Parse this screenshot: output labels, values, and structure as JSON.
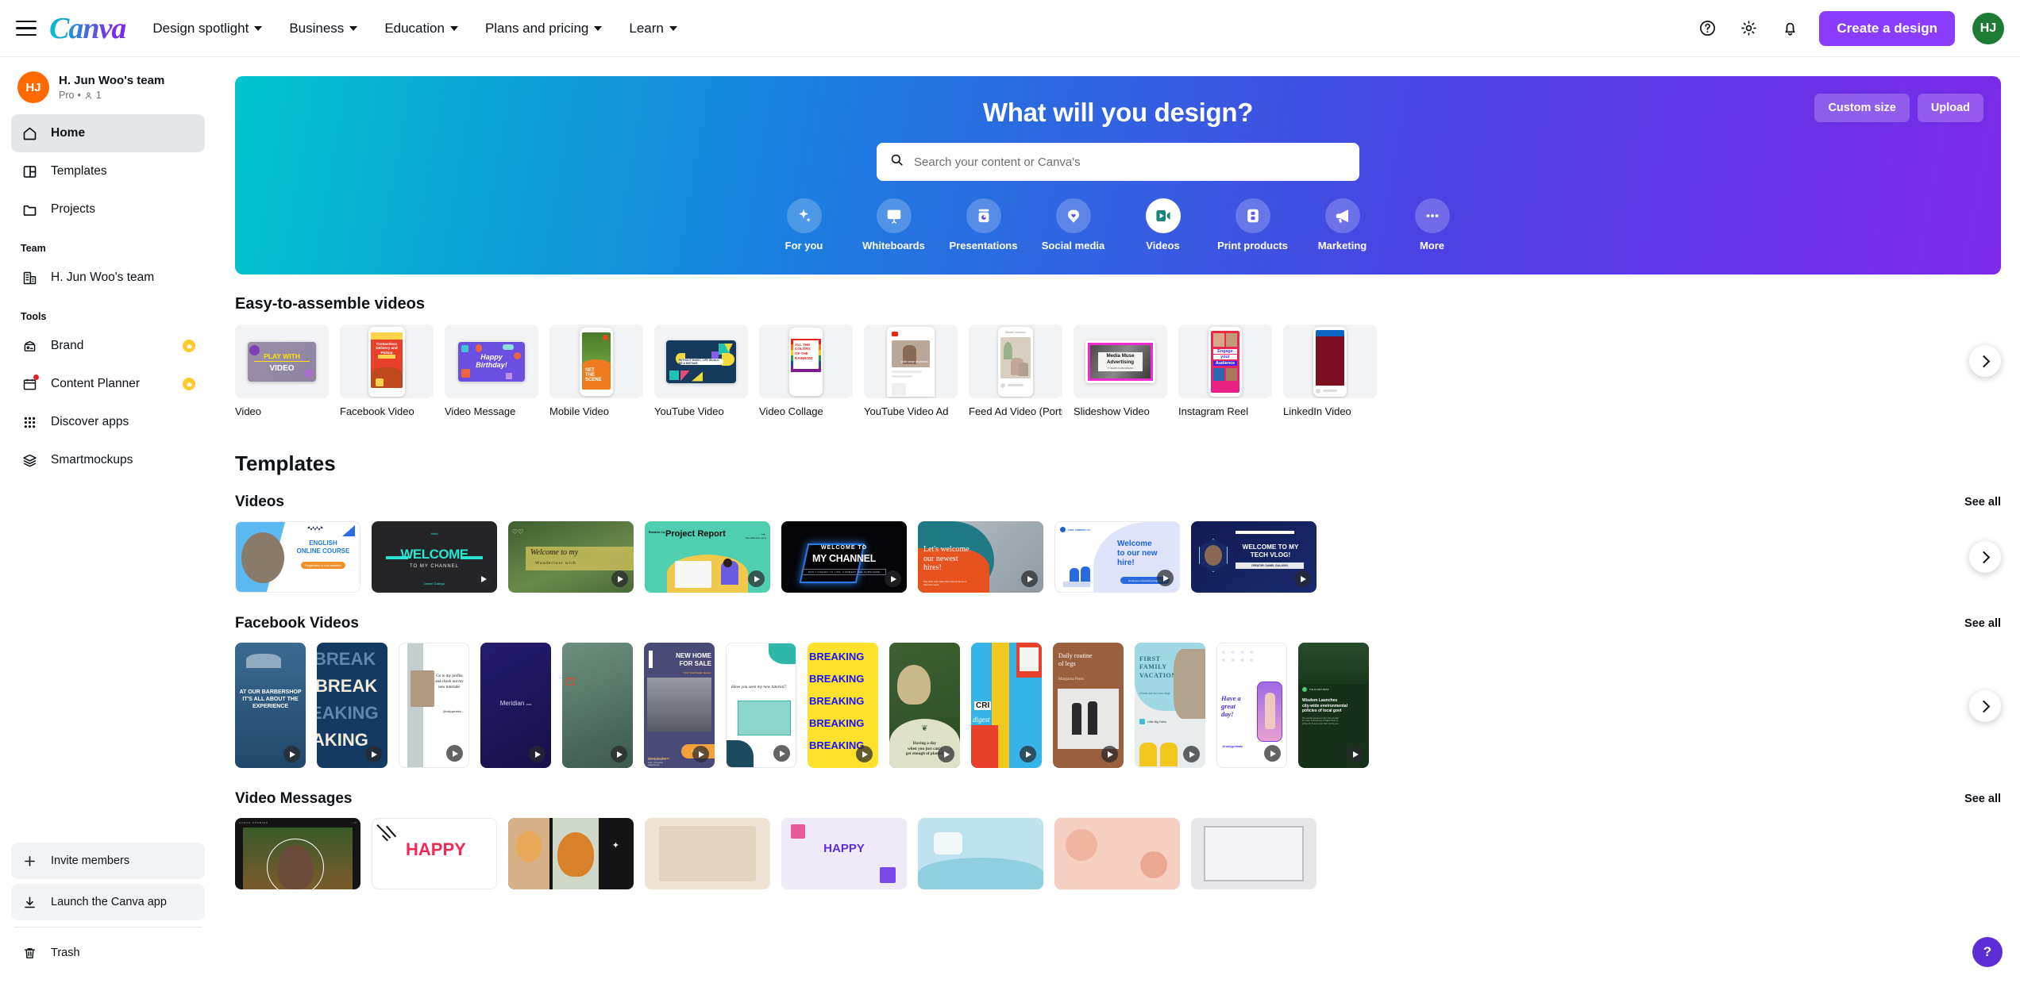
{
  "topnav": {
    "logo": "Canva",
    "menu_icon": "hamburger-icon",
    "links": [
      {
        "label": "Design spotlight"
      },
      {
        "label": "Business"
      },
      {
        "label": "Education"
      },
      {
        "label": "Plans and pricing"
      },
      {
        "label": "Learn"
      }
    ],
    "help_icon": "help-circle-icon",
    "settings_icon": "gear-icon",
    "notifications_icon": "bell-icon",
    "create_button": "Create a design",
    "avatar_initials": "HJ",
    "avatar_color": "#1e7b34",
    "create_button_color": "#8b3dff"
  },
  "sidebar": {
    "team": {
      "initials": "HJ",
      "avatar_color": "#ff6a00",
      "name": "H. Jun Woo's team",
      "plan": "Pro",
      "separator": "•",
      "members": "1"
    },
    "nav": [
      {
        "label": "Home",
        "icon": "home-icon",
        "active": true
      },
      {
        "label": "Templates",
        "icon": "templates-icon",
        "active": false
      },
      {
        "label": "Projects",
        "icon": "folder-icon",
        "active": false
      }
    ],
    "team_section_label": "Team",
    "team_items": [
      {
        "label": "H. Jun Woo's team",
        "icon": "building-icon"
      }
    ],
    "tools_section_label": "Tools",
    "tools": [
      {
        "label": "Brand",
        "icon": "brand-icon",
        "pro": true,
        "badge": false
      },
      {
        "label": "Content Planner",
        "icon": "calendar-icon",
        "pro": true,
        "badge": true
      },
      {
        "label": "Discover apps",
        "icon": "grid-apps-icon",
        "pro": false,
        "badge": false
      },
      {
        "label": "Smartmockups",
        "icon": "layers-icon",
        "pro": false,
        "badge": false
      }
    ],
    "bottom": [
      {
        "label": "Invite members",
        "icon": "plus-icon"
      },
      {
        "label": "Launch the Canva app",
        "icon": "download-icon"
      }
    ],
    "trash": {
      "label": "Trash",
      "icon": "trash-icon"
    }
  },
  "hero": {
    "title": "What will you design?",
    "search_placeholder": "Search your content or Canva's",
    "search_value": "",
    "search_icon": "search-icon",
    "custom_size_button": "Custom size",
    "upload_button": "Upload",
    "categories": [
      {
        "label": "For you",
        "icon": "sparkle-icon",
        "selected": false
      },
      {
        "label": "Whiteboards",
        "icon": "whiteboard-icon",
        "selected": false
      },
      {
        "label": "Presentations",
        "icon": "presentation-icon",
        "selected": false
      },
      {
        "label": "Social media",
        "icon": "social-heart-icon",
        "selected": false
      },
      {
        "label": "Videos",
        "icon": "video-camera-icon",
        "selected": true
      },
      {
        "label": "Print products",
        "icon": "print-icon",
        "selected": false
      },
      {
        "label": "Marketing",
        "icon": "megaphone-icon",
        "selected": false
      },
      {
        "label": "More",
        "icon": "ellipsis-icon",
        "selected": false
      }
    ]
  },
  "easy_section": {
    "title": "Easy-to-assemble videos",
    "cards": [
      {
        "label": "Video",
        "art": "play-with-video"
      },
      {
        "label": "Facebook Video",
        "art": "contactless-delivery"
      },
      {
        "label": "Video Message",
        "art": "happy-birthday"
      },
      {
        "label": "Mobile Video",
        "art": "set-the-scene"
      },
      {
        "label": "YouTube Video",
        "art": "without-music"
      },
      {
        "label": "Video Collage",
        "art": "colors-rainbow"
      },
      {
        "label": "YouTube Video Ad",
        "art": "youtube-ad"
      },
      {
        "label": "Feed Ad Video (Portrait)",
        "art": "feed-ad"
      },
      {
        "label": "Slideshow Video",
        "art": "media-muse"
      },
      {
        "label": "Instagram Reel",
        "art": "engage-audience"
      },
      {
        "label": "LinkedIn Video",
        "art": "linkedin-video"
      }
    ]
  },
  "templates": {
    "title": "Templates",
    "rows": [
      {
        "title": "Videos",
        "see_all": "See all",
        "items": [
          {
            "art": "english-online-course",
            "caption": "ENGLISH ONLINE COURSE",
            "bg": "#ffffff",
            "fg": "#1f7ae0",
            "play": false
          },
          {
            "art": "welcome-channel-dark",
            "caption": "WELCOME",
            "bg": "#252528",
            "fg": "#2ae3d0",
            "play": true
          },
          {
            "art": "welcome-wanderlust",
            "caption": "Welcome to my channel",
            "bg": "#4c6b3c",
            "fg": "#ffffff",
            "play": true
          },
          {
            "art": "project-report",
            "caption": "Project Report",
            "bg": "#4fcfb0",
            "fg": "#101010",
            "play": true
          },
          {
            "art": "my-channel-neon",
            "caption": "WELCOME TO MY CHANNEL",
            "bg": "#050507",
            "fg": "#ffffff",
            "play": true
          },
          {
            "art": "newest-hires",
            "caption": "Let's welcome our newest hires!",
            "bg": "#e8521f",
            "fg": "#ffffff",
            "play": true
          },
          {
            "art": "welcome-new-hire",
            "caption": "Welcome to our new hire!",
            "bg": "#eceefb",
            "fg": "#1c62d6",
            "play": true
          },
          {
            "art": "tech-vlog",
            "caption": "WELCOME TO MY TECH VLOG!",
            "bg": "#101a4d",
            "fg": "#ffffff",
            "play": true
          }
        ]
      },
      {
        "title": "Facebook Videos",
        "see_all": "See all",
        "items": [
          {
            "art": "barbershop",
            "caption": "AT OUR BARBERSHOP IT'S ALL ABOUT THE EXPERIENCE",
            "bg": "#2c5a82",
            "fg": "#ffffff",
            "play": true
          },
          {
            "art": "breaking-blue",
            "caption": "BREAKING",
            "bg": "#123a63",
            "fg": "#f2ead6",
            "play": true
          },
          {
            "art": "tutorials-profile",
            "caption": "Go to my profile and check out my new tutorials!",
            "bg": "#ffffff",
            "fg": "#101010",
            "play": true
          },
          {
            "art": "meridian",
            "caption": "Meridian",
            "bg": "#221b66",
            "fg": "#dcdcf5",
            "play": true
          },
          {
            "art": "teal-texture",
            "caption": "",
            "bg": "#5f7f72",
            "fg": "#ffffff",
            "play": true
          },
          {
            "art": "new-home-for-sale",
            "caption": "NEW HOME FOR SALE",
            "bg": "#4a4a78",
            "fg": "#ffffff",
            "play": true
          },
          {
            "art": "seen-my-tutorial",
            "caption": "Have you seen my new tutorial?",
            "bg": "#ffffff",
            "fg": "#101010",
            "play": true
          },
          {
            "art": "breaking-yellow",
            "caption": "BREAKING",
            "bg": "#ffe02a",
            "fg": "#1414ff",
            "play": true
          },
          {
            "art": "plants-day",
            "caption": "Having a day when you just can't get enough of plants?",
            "bg": "#4a6a3a",
            "fg": "#ffffff",
            "play": true
          },
          {
            "art": "scri-digest",
            "caption": "digest",
            "bg": "#36b4e8",
            "fg": "#ffffff",
            "play": true
          },
          {
            "art": "daily-routine-legs",
            "caption": "Daily routine of legs",
            "bg": "#9a5f3c",
            "fg": "#ffffff",
            "play": true
          },
          {
            "art": "first-family-vacation",
            "caption": "FIRST FAMILY VACATION",
            "bg": "#9fd8e3",
            "fg": "#2b6f80",
            "play": true
          },
          {
            "art": "have-a-great-day",
            "caption": "Have a great day!",
            "bg": "#ffffff",
            "fg": "#5b2ed6",
            "play": true
          },
          {
            "art": "green-news",
            "caption": "",
            "bg": "#17301a",
            "fg": "#ffffff",
            "play": true
          }
        ]
      },
      {
        "title": "Video Messages",
        "see_all": "See all",
        "items": [
          {
            "art": "canva-stories-dark",
            "caption": "",
            "bg": "#141414",
            "fg": "#ffffff",
            "play": false
          },
          {
            "art": "happy-arrow",
            "caption": "HAPPY",
            "bg": "#ffffff",
            "fg": "#ef2a55",
            "play": false
          },
          {
            "art": "pets-sparkle",
            "caption": "",
            "bg": "#c78a5a",
            "fg": "#ffffff",
            "play": false
          },
          {
            "art": "soft-beige",
            "caption": "",
            "bg": "#efe3d6",
            "fg": "#7a5c44",
            "play": false
          },
          {
            "art": "purple-gift",
            "caption": "HAPPY",
            "bg": "#f0eaf8",
            "fg": "#5b2ed6",
            "play": false
          },
          {
            "art": "ocean-blue",
            "caption": "",
            "bg": "#bfe3ee",
            "fg": "#2b6f80",
            "play": false
          },
          {
            "art": "peach-floral",
            "caption": "",
            "bg": "#f7cfc0",
            "fg": "#a85c42",
            "play": false
          },
          {
            "art": "grey-frame",
            "caption": "",
            "bg": "#e7e7e9",
            "fg": "#333333",
            "play": false
          }
        ]
      }
    ]
  },
  "help_fab": {
    "label": "?",
    "icon": "question-icon",
    "color": "#5b2ed6"
  },
  "carousel": {
    "next_icon": "chevron-right-icon"
  }
}
